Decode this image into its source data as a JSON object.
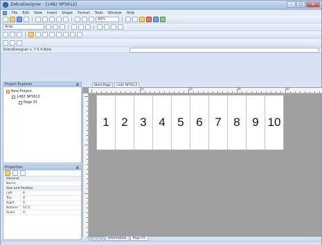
{
  "window": {
    "title": "ZebraDesigner - [1482 NP5612]"
  },
  "menubar": {
    "items": [
      "File",
      "Edit",
      "View",
      "Insert",
      "Shape",
      "Format",
      "Tools",
      "Window",
      "Help"
    ]
  },
  "toolbar": {
    "zoom": "40%",
    "font": "Arial"
  },
  "status_row": {
    "version": "ZebraDesigner v. 7.5.4 Beta"
  },
  "project_explorer": {
    "title": "Project Explorer",
    "tree": [
      {
        "label": "New Project",
        "level": 0
      },
      {
        "label": "1482 NP5612",
        "level": 1
      },
      {
        "label": "Page 01",
        "level": 2
      }
    ]
  },
  "properties": {
    "title": "Properties",
    "rows": [
      {
        "key": "General",
        "group": true
      },
      {
        "key": "Name",
        "value": ""
      },
      {
        "key": "Size and Position",
        "group": true
      },
      {
        "key": "Left",
        "value": "0"
      },
      {
        "key": "Top",
        "value": "0"
      },
      {
        "key": "Right",
        "value": "4"
      },
      {
        "key": "Bottom",
        "value": "12.5"
      },
      {
        "key": "Scale",
        "value": "0"
      }
    ]
  },
  "document_tabs": [
    {
      "label": "Start Page",
      "active": false
    },
    {
      "label": "1482 NP5612",
      "active": true
    }
  ],
  "ruler": {
    "top_marks": [
      "10",
      "20",
      "30",
      "40"
    ]
  },
  "label_sheet": {
    "cells": [
      "1",
      "2",
      "3",
      "4",
      "5",
      "6",
      "7",
      "8",
      "9",
      "10"
    ]
  },
  "page_tabs": [
    {
      "label": "Information",
      "active": false
    },
    {
      "label": "Page 01",
      "active": true
    }
  ],
  "colors": {
    "chrome": "#d6e2f1",
    "canvas": "#9f9f9f",
    "panel_header": "#a7c0e2"
  }
}
